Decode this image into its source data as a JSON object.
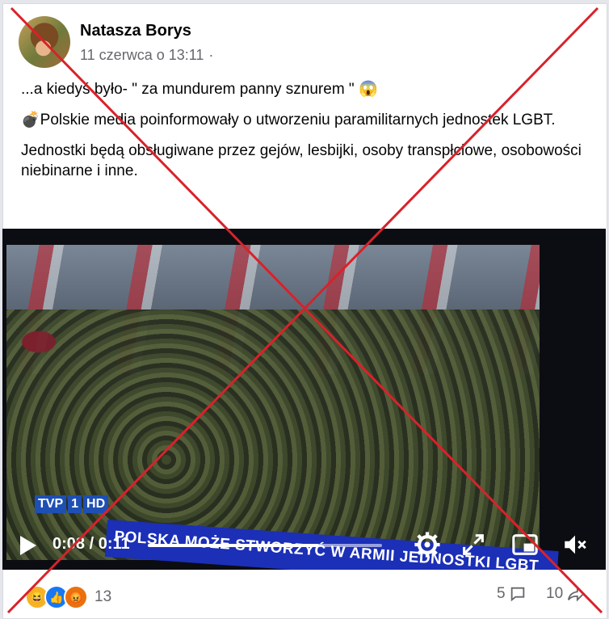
{
  "post": {
    "author": "Natasza Borys",
    "date": "11 czerwca o 13:11",
    "separator": "·",
    "lines": [
      "...a kiedyś było- \" za mundurem panny sznurem \"",
      "Polskie media poinformowały o utworzeniu paramilitarnych jednostek LGBT.",
      "Jednostki będą obsługiwane przez gejów, lesbijki, osoby transpłciowe, osobowości niebinarne i inne."
    ]
  },
  "video": {
    "channel_logo": [
      "TVP",
      "1",
      "HD"
    ],
    "ticker": "POLSKA MOŻE STWORZYĆ W ARMII JEDNOSTKI LGBT",
    "time": "0:08 / 0:11",
    "progress": 0.73
  },
  "footer": {
    "reactions_count": "13",
    "comments_count": "5",
    "shares_count": "10"
  },
  "icons": {
    "bomb": "bomb-emoji",
    "fear": "fearful-face-emoji",
    "reactions": [
      "haha-icon",
      "like-icon",
      "angry-icon"
    ]
  },
  "colors": {
    "cross": "#d8222a",
    "like": "#1877f2",
    "ticker": "#1b2fb7"
  }
}
